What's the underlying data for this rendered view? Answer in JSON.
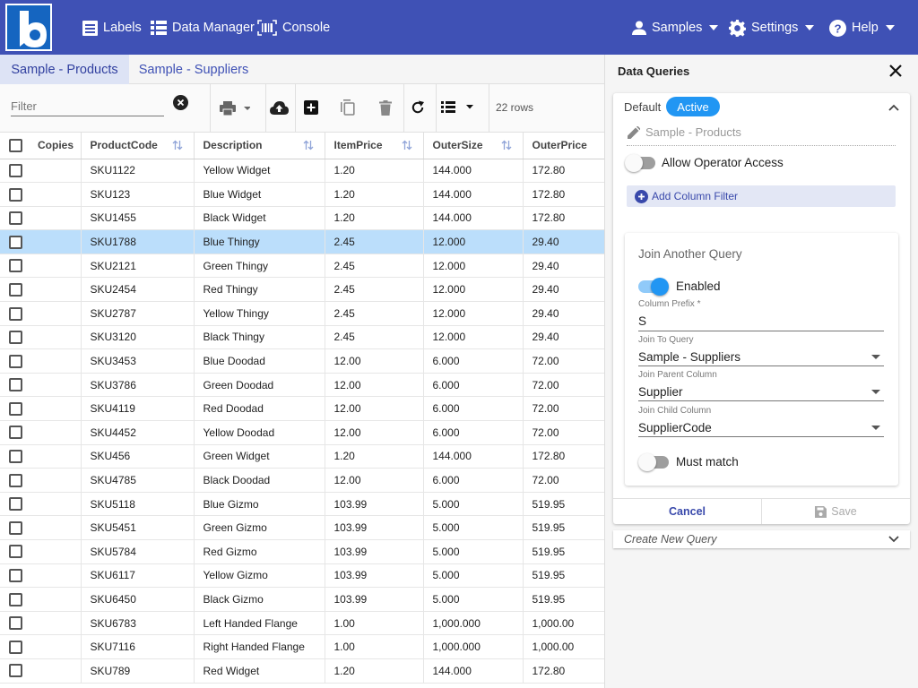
{
  "nav": {
    "labels": "Labels",
    "data_manager": "Data Manager",
    "console": "Console",
    "samples": "Samples",
    "settings": "Settings",
    "help": "Help"
  },
  "tabs": [
    "Sample - Products",
    "Sample - Suppliers"
  ],
  "toolbar": {
    "filter_placeholder": "Filter",
    "row_count": "22 rows"
  },
  "grid": {
    "columns": [
      "Copies",
      "ProductCode",
      "Description",
      "ItemPrice",
      "OuterSize",
      "OuterPrice"
    ],
    "rows": [
      [
        "SKU1122",
        "Yellow Widget",
        "1.20",
        "144.000",
        "172.80"
      ],
      [
        "SKU123",
        "Blue Widget",
        "1.20",
        "144.000",
        "172.80"
      ],
      [
        "SKU1455",
        "Black Widget",
        "1.20",
        "144.000",
        "172.80"
      ],
      [
        "SKU1788",
        "Blue Thingy",
        "2.45",
        "12.000",
        "29.40"
      ],
      [
        "SKU2121",
        "Green Thingy",
        "2.45",
        "12.000",
        "29.40"
      ],
      [
        "SKU2454",
        "Red Thingy",
        "2.45",
        "12.000",
        "29.40"
      ],
      [
        "SKU2787",
        "Yellow Thingy",
        "2.45",
        "12.000",
        "29.40"
      ],
      [
        "SKU3120",
        "Black Thingy",
        "2.45",
        "12.000",
        "29.40"
      ],
      [
        "SKU3453",
        "Blue Doodad",
        "12.00",
        "6.000",
        "72.00"
      ],
      [
        "SKU3786",
        "Green Doodad",
        "12.00",
        "6.000",
        "72.00"
      ],
      [
        "SKU4119",
        "Red Doodad",
        "12.00",
        "6.000",
        "72.00"
      ],
      [
        "SKU4452",
        "Yellow Doodad",
        "12.00",
        "6.000",
        "72.00"
      ],
      [
        "SKU456",
        "Green Widget",
        "1.20",
        "144.000",
        "172.80"
      ],
      [
        "SKU4785",
        "Black Doodad",
        "12.00",
        "6.000",
        "72.00"
      ],
      [
        "SKU5118",
        "Blue Gizmo",
        "103.99",
        "5.000",
        "519.95"
      ],
      [
        "SKU5451",
        "Green Gizmo",
        "103.99",
        "5.000",
        "519.95"
      ],
      [
        "SKU5784",
        "Red Gizmo",
        "103.99",
        "5.000",
        "519.95"
      ],
      [
        "SKU6117",
        "Yellow Gizmo",
        "103.99",
        "5.000",
        "519.95"
      ],
      [
        "SKU6450",
        "Black Gizmo",
        "103.99",
        "5.000",
        "519.95"
      ],
      [
        "SKU6783",
        "Left Handed Flange",
        "1.00",
        "1,000.000",
        "1,000.00"
      ],
      [
        "SKU7116",
        "Right Handed Flange",
        "1.00",
        "1,000.000",
        "1,000.00"
      ],
      [
        "SKU789",
        "Red Widget",
        "1.20",
        "144.000",
        "172.80"
      ]
    ],
    "selected_row": 3
  },
  "panel": {
    "title": "Data Queries",
    "query_name": "Default",
    "status": "Active",
    "source_name": "Sample - Products",
    "allow_operator_access": "Allow Operator Access",
    "add_column_filter": "Add Column Filter",
    "join": {
      "title": "Join Another Query",
      "enabled_label": "Enabled",
      "column_prefix_label": "Column Prefix *",
      "column_prefix_value": "S",
      "join_to_query_label": "Join To Query",
      "join_to_query_value": "Sample - Suppliers",
      "join_parent_label": "Join Parent Column",
      "join_parent_value": "Supplier",
      "join_child_label": "Join Child Column",
      "join_child_value": "SupplierCode",
      "must_match_label": "Must match"
    },
    "cancel": "Cancel",
    "save": "Save",
    "create_new_query": "Create New Query"
  },
  "colors": {
    "brand": "#3f51b5",
    "accent": "#2196f3",
    "selected_row": "#bbdefb"
  }
}
